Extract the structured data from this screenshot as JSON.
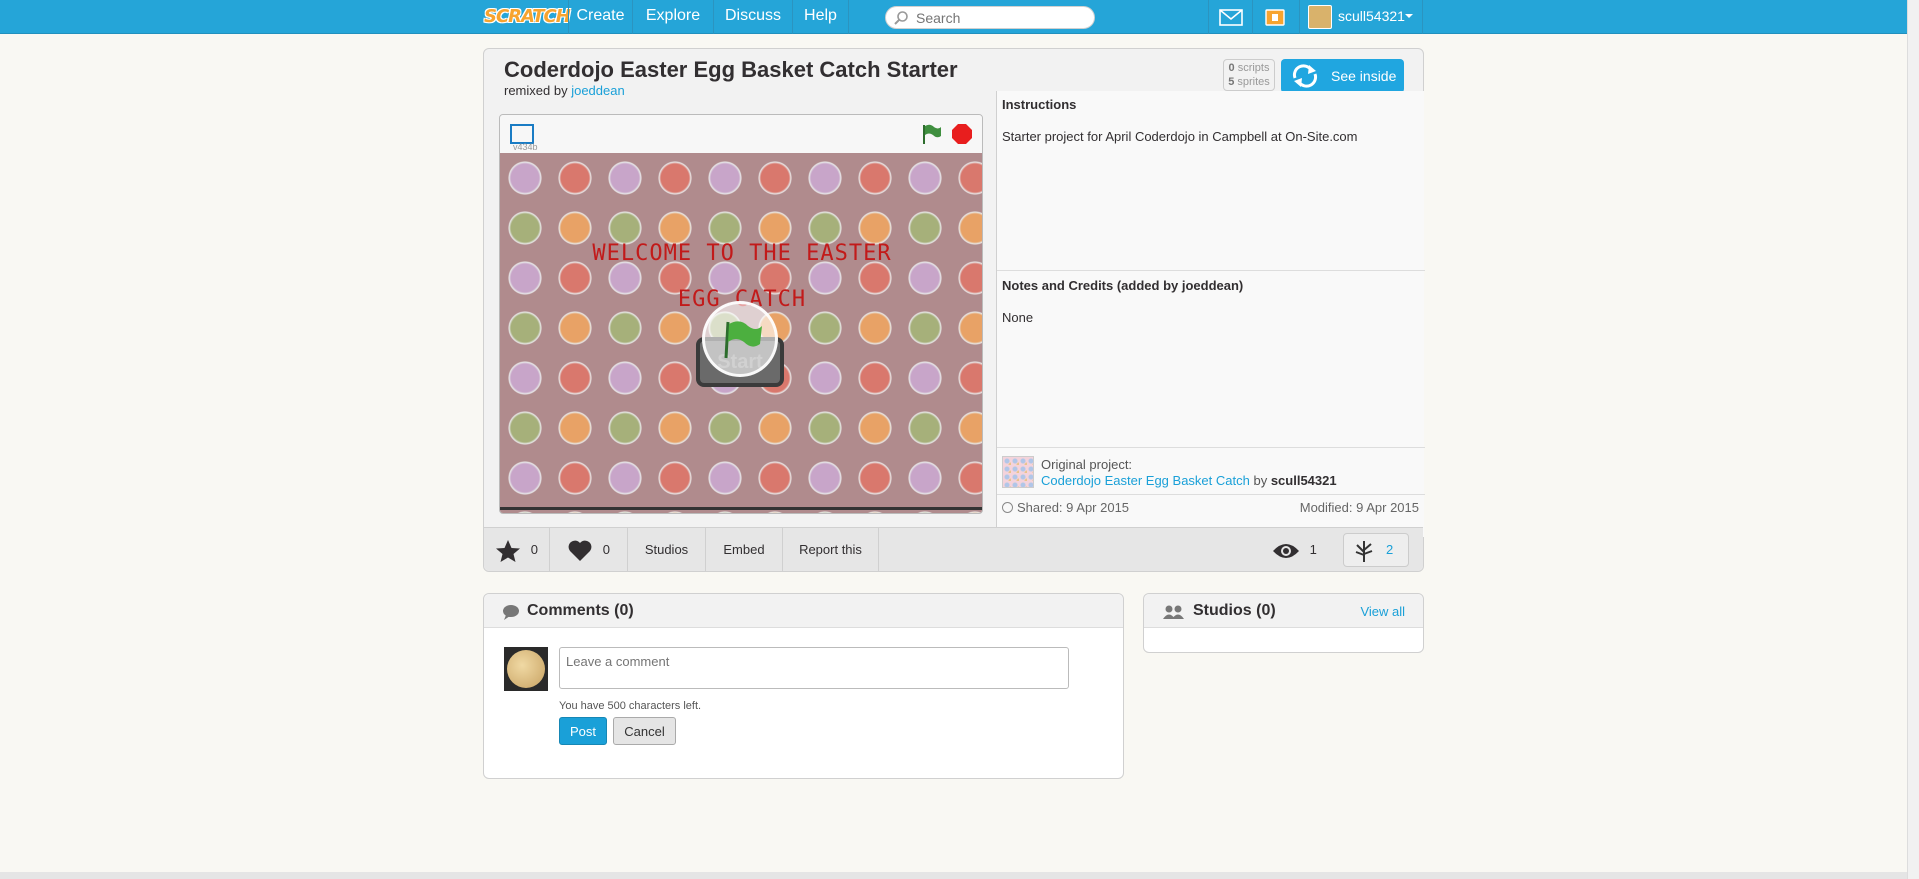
{
  "nav": {
    "logo": "SCRATCH",
    "links": [
      "Create",
      "Explore",
      "Discuss",
      "Help"
    ],
    "search_placeholder": "Search",
    "username": "scull54321"
  },
  "project": {
    "title": "Coderdojo Easter Egg Basket Catch Starter",
    "remixed_by_prefix": "remixed by",
    "remixed_by_user": "joeddean",
    "scripts_count": "0",
    "scripts_label": "scripts",
    "sprites_count": "5",
    "sprites_label": "sprites",
    "see_inside_label": "See inside",
    "player_version": "v434b",
    "stage_text_line1": "WELCOME TO THE EASTER",
    "stage_text_line2": "EGG CATCH",
    "stage_button": "Start",
    "instructions_heading": "Instructions",
    "instructions_text": "Starter project for April Coderdojo in Campbell at On-Site.com",
    "notes_heading": "Notes and Credits (added by joeddean)",
    "notes_text": "None",
    "original_label": "Original project:",
    "original_title": "Coderdojo Easter Egg Basket Catch",
    "original_by": "by",
    "original_author": "scull54321",
    "shared": "Shared: 9 Apr 2015",
    "modified": "Modified: 9 Apr 2015",
    "favorites": "0",
    "loves": "0",
    "studios_label": "Studios",
    "embed_label": "Embed",
    "report_label": "Report this",
    "views": "1",
    "remixes": "2"
  },
  "comments": {
    "heading": "Comments (0)",
    "placeholder": "Leave a comment",
    "chars_left": "You have 500 characters left.",
    "post_label": "Post",
    "cancel_label": "Cancel"
  },
  "studios": {
    "heading": "Studios (0)",
    "view_all": "View all"
  },
  "colors": {
    "topbar": "#25a5d8",
    "link": "#1aa0d8",
    "accent_button": "#20a6e0"
  }
}
